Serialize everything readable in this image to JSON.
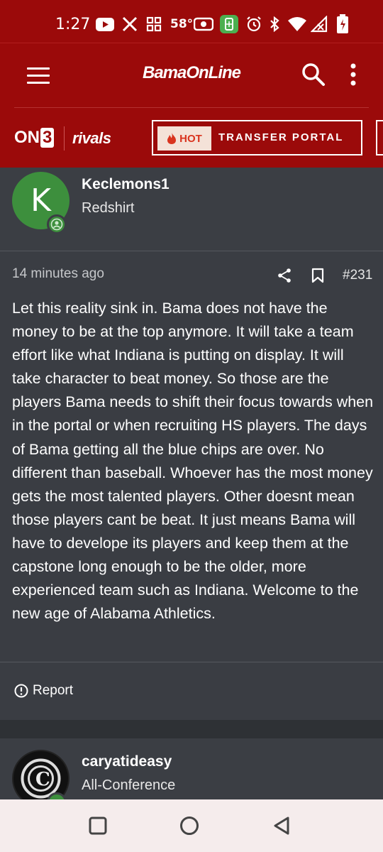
{
  "status_bar": {
    "time": "1:27",
    "temperature": "58°",
    "icons": [
      "youtube-icon",
      "x-icon",
      "apps-icon",
      "temperature",
      "camera-icon",
      "battery-saver-icon",
      "alarm-icon",
      "bluetooth-icon",
      "wifi-icon",
      "signal-icon",
      "battery-icon"
    ]
  },
  "header": {
    "logo_text": "BamaOnLine"
  },
  "brand_bar": {
    "on3_text": "ON",
    "on3_number": "3",
    "rivals_text": "rivals",
    "hot_label": "HOT",
    "portal_label": "TRANSFER PORTAL"
  },
  "post_author": {
    "avatar_letter": "K",
    "username": "Keclemons1",
    "title": "Redshirt"
  },
  "post": {
    "time_ago": "14 minutes ago",
    "post_number": "#231",
    "body": "Let this reality sink in. Bama does not have the money to be at the top anymore. It will take a team effort like what Indiana is putting on display. It will take character to beat money. So those are the players Bama needs to shift their focus towards when in the portal or when recruiting HS players. The days of Bama getting all the blue chips are over. No different than baseball. Whoever has the most money gets the most talented players. Other doesnt mean those players cant be beat. It just means Bama will have to develope its players and keep them at the capstone long enough to be the older, more experienced team such as Indiana. Welcome to the new age of Alabama Athletics.",
    "report_label": "Report"
  },
  "next_author": {
    "username": "caryatideasy",
    "title": "All-Conference"
  },
  "colors": {
    "brand_red": "#9b0a0a",
    "online_green": "#3d8f3d",
    "hot_orange": "#d9341f"
  }
}
